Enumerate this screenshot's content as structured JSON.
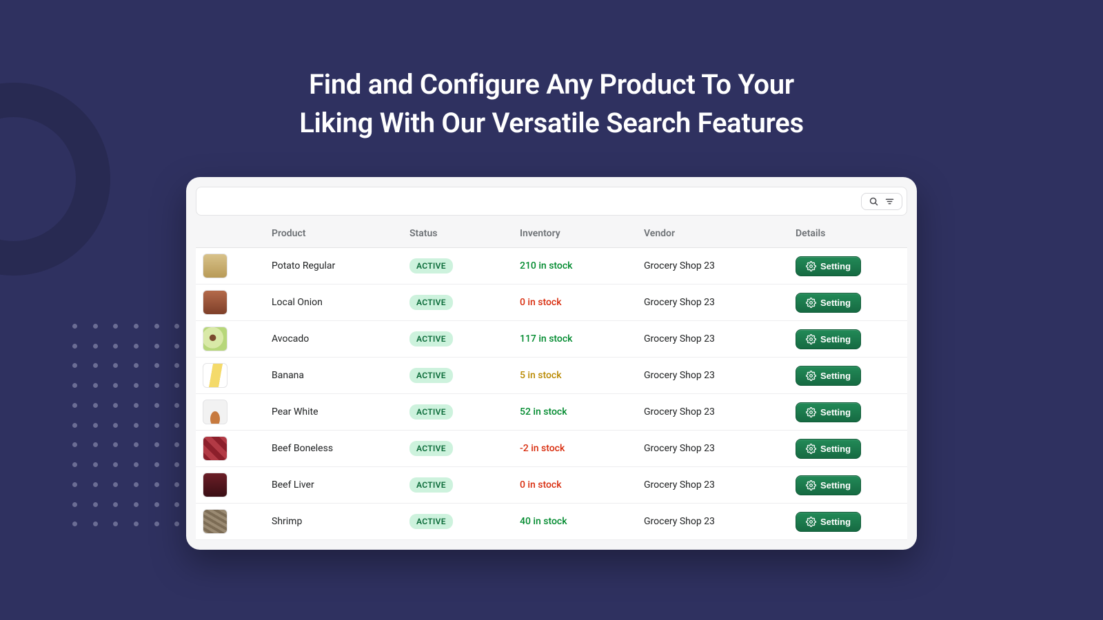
{
  "headline": {
    "line1": "Find and Configure Any Product To Your",
    "line2": "Liking With Our Versatile Search Features"
  },
  "table": {
    "headers": {
      "product": "Product",
      "status": "Status",
      "inventory": "Inventory",
      "vendor": "Vendor",
      "details": "Details"
    },
    "setting_label": "Setting",
    "rows": [
      {
        "thumb_bg": "linear-gradient(#d8c28a,#b89a57)",
        "product": "Potato Regular",
        "status": "ACTIVE",
        "inventory_qty": 210,
        "inventory_text": "210 in stock",
        "inventory_state": "ok",
        "vendor": "Grocery Shop 23"
      },
      {
        "thumb_bg": "linear-gradient(#b46a4a,#7e3f29)",
        "product": "Local Onion",
        "status": "ACTIVE",
        "inventory_qty": 0,
        "inventory_text": "0 in stock",
        "inventory_state": "out",
        "vendor": "Grocery Shop 23"
      },
      {
        "thumb_bg": "radial-gradient(circle at 40% 45%, #7a4a2d 0 16%, #d9e9a8 18% 55%, #b7d77a 56% 100%)",
        "product": "Avocado",
        "status": "ACTIVE",
        "inventory_qty": 117,
        "inventory_text": "117 in stock",
        "inventory_state": "ok",
        "vendor": "Grocery Shop 23"
      },
      {
        "thumb_bg": "linear-gradient(100deg,#fff 0 35%,#f4da6a 35% 70%,#fff 70%)",
        "product": "Banana",
        "status": "ACTIVE",
        "inventory_qty": 5,
        "inventory_text": "5 in stock",
        "inventory_state": "low",
        "vendor": "Grocery Shop 23"
      },
      {
        "thumb_bg": "radial-gradient(ellipse at 50% 80%, #c77a3e 0 28%, #f2f2f2 30% 100%)",
        "product": "Pear White",
        "status": "ACTIVE",
        "inventory_qty": 52,
        "inventory_text": "52 in stock",
        "inventory_state": "ok",
        "vendor": "Grocery Shop 23"
      },
      {
        "thumb_bg": "repeating-linear-gradient(45deg,#8c1f2b 0 8px,#b23a45 8px 16px)",
        "product": "Beef Boneless",
        "status": "ACTIVE",
        "inventory_qty": -2,
        "inventory_text": "-2 in stock",
        "inventory_state": "out",
        "vendor": "Grocery Shop 23"
      },
      {
        "thumb_bg": "linear-gradient(#6b1e27,#3a0e14)",
        "product": "Beef Liver",
        "status": "ACTIVE",
        "inventory_qty": 0,
        "inventory_text": "0 in stock",
        "inventory_state": "out",
        "vendor": "Grocery Shop 23"
      },
      {
        "thumb_bg": "repeating-linear-gradient(30deg,#9a8a72 0 4px,#7c6c55 4px 8px)",
        "product": "Shrimp",
        "status": "ACTIVE",
        "inventory_qty": 40,
        "inventory_text": "40 in stock",
        "inventory_state": "ok",
        "vendor": "Grocery Shop 23"
      }
    ]
  }
}
